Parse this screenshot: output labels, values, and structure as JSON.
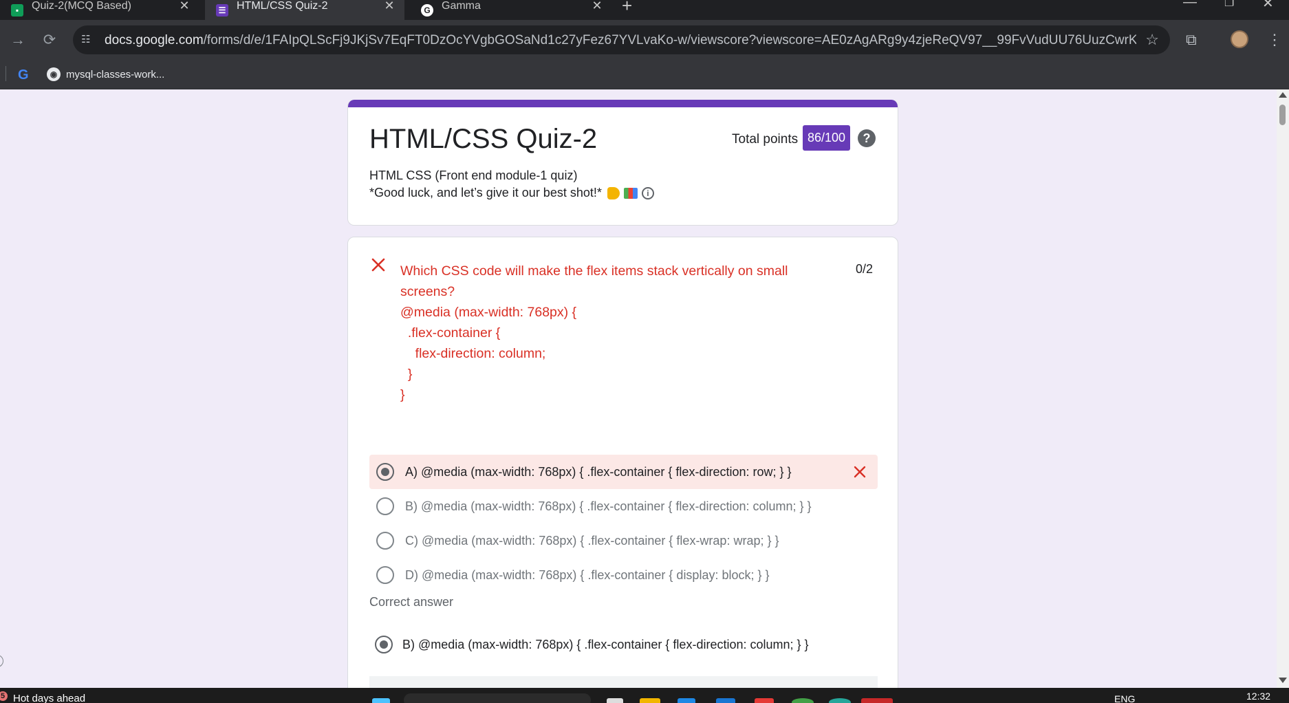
{
  "browser": {
    "tabs": [
      {
        "title": "Quiz-2(MCQ Based)",
        "icon": "google-forms-green-icon",
        "active": false
      },
      {
        "title": "HTML/CSS Quiz-2",
        "icon": "google-forms-purple-icon",
        "active": true
      },
      {
        "title": "Gamma",
        "icon": "gamma-icon",
        "active": false
      }
    ],
    "url_host": "docs.google.com",
    "url_path": "/forms/d/e/1FAIpQLScFj9JKjSv7EqFT0DzOcYVgbGOSaNd1c27yFez67YVLvaKo-w/viewscore?viewscore=AE0zAgARg9y4zjeReQV97__99FvVudUU76UuzCwrKFaIT1Jk9wItcfRjOe94...",
    "bookmarks": [
      {
        "label": "",
        "icon": "google-icon"
      },
      {
        "label": "mysql-classes-work...",
        "icon": "github-icon"
      }
    ]
  },
  "form": {
    "title": "HTML/CSS Quiz-2",
    "points_label": "Total points",
    "points_value": "86/100",
    "description_line1": "HTML CSS (Front end module-1 quiz)",
    "description_line2": "*Good luck, and let’s give it our best shot!*"
  },
  "question": {
    "text": "Which CSS code will make the flex items stack vertically on small\nscreens?\n@media (max-width: 768px) {\n  .flex-container {\n    flex-direction: column;\n  }\n}",
    "score": "0/2",
    "status": "incorrect",
    "options": [
      {
        "label": "A) @media (max-width: 768px) { .flex-container { flex-direction: row; } }",
        "selected": true,
        "wrong": true
      },
      {
        "label": "B) @media (max-width: 768px) { .flex-container { flex-direction: column; } }",
        "selected": false,
        "wrong": false
      },
      {
        "label": "C) @media (max-width: 768px) { .flex-container { flex-wrap: wrap; } }",
        "selected": false,
        "wrong": false
      },
      {
        "label": "D) @media (max-width: 768px) { .flex-container { display: block; } }",
        "selected": false,
        "wrong": false
      }
    ],
    "correct_answer_heading": "Correct answer",
    "correct_answer": "B) @media (max-width: 768px) { .flex-container { flex-direction: column; } }"
  },
  "taskbar": {
    "weather_badge": "5",
    "weather_text": "Hot days ahead",
    "language": "ENG",
    "time": "12:32"
  },
  "colors": {
    "accent": "#673ab7",
    "error": "#d93025",
    "wrong_bg": "#fce8e6",
    "page_bg": "#f0ebf8"
  }
}
